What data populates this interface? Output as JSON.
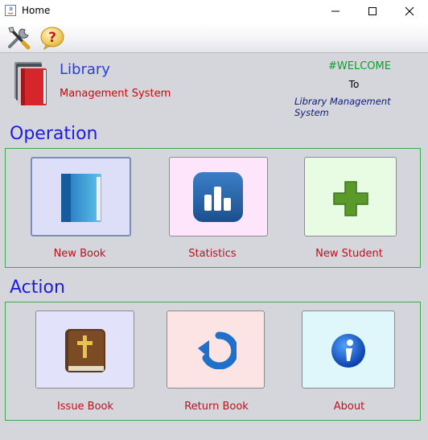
{
  "window": {
    "title": "Home"
  },
  "header": {
    "title": "Library",
    "subtitle": "Management System",
    "welcome": "#WELCOME",
    "to": "To",
    "system_name": "Library Management System"
  },
  "operation": {
    "title": "Operation",
    "items": [
      {
        "label": "New Book",
        "icon": "book-icon"
      },
      {
        "label": "Statistics",
        "icon": "statistics-icon"
      },
      {
        "label": "New Student",
        "icon": "plus-icon"
      }
    ]
  },
  "action": {
    "title": "Action",
    "items": [
      {
        "label": "Issue Book",
        "icon": "bible-icon"
      },
      {
        "label": "Return Book",
        "icon": "return-arrow-icon"
      },
      {
        "label": "About",
        "icon": "info-icon"
      }
    ]
  },
  "colors": {
    "section_title": "#1d1be6",
    "label": "#c0101c",
    "welcome": "#0ba02c",
    "panel_border": "#3ea84e"
  }
}
